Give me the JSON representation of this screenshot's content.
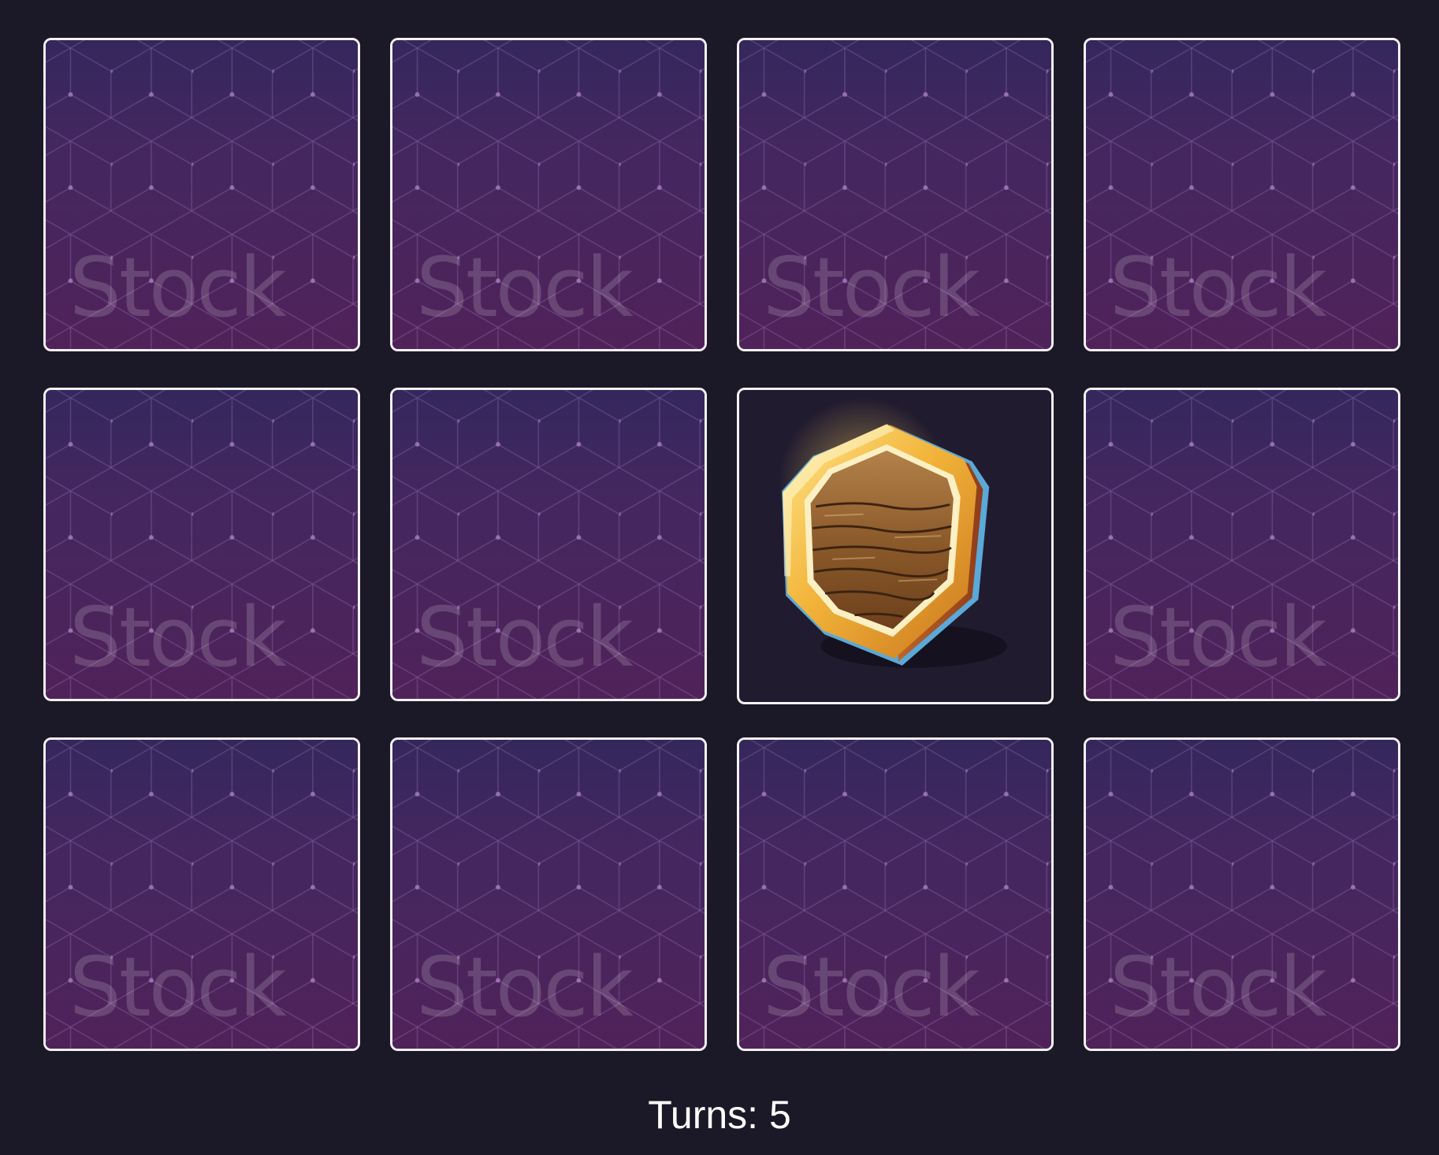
{
  "board": {
    "rows": 3,
    "columns": 4,
    "card_back_watermark": "Stock",
    "cards": [
      {
        "state": "face-down"
      },
      {
        "state": "face-down"
      },
      {
        "state": "face-down"
      },
      {
        "state": "face-down"
      },
      {
        "state": "face-down"
      },
      {
        "state": "face-down"
      },
      {
        "state": "face-up",
        "icon": "wooden-shield-icon"
      },
      {
        "state": "face-down"
      },
      {
        "state": "face-down"
      },
      {
        "state": "face-down"
      },
      {
        "state": "face-down"
      },
      {
        "state": "face-down"
      }
    ]
  },
  "status": {
    "turns_label": "Turns: 5"
  },
  "colors": {
    "background": "#1b1827",
    "card_border": "#f4f1f8",
    "card_back_top": "#3a2a63",
    "card_back_bottom": "#50225a",
    "shield_gold": "#f2b43a",
    "shield_wood": "#9a6a34"
  }
}
